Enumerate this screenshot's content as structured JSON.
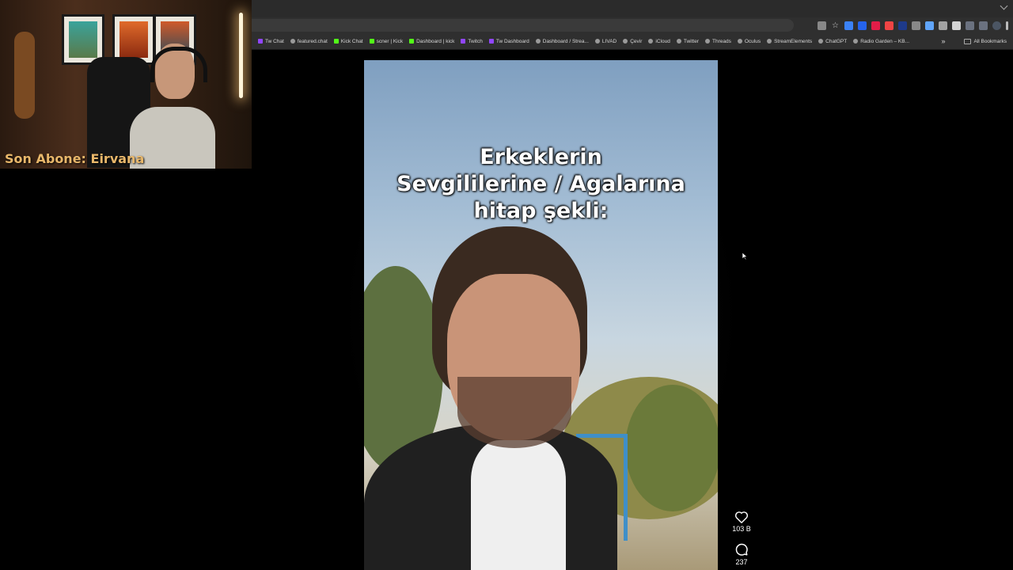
{
  "browser": {
    "bookmarks": [
      {
        "label": "Tw Chat",
        "icon": "twitch-icon"
      },
      {
        "label": "featured.chat",
        "icon": "globe-icon"
      },
      {
        "label": "Kick Chat",
        "icon": "kick-icon"
      },
      {
        "label": "scner | Kick",
        "icon": "kick-icon"
      },
      {
        "label": "Dashboard | kick",
        "icon": "kick-icon"
      },
      {
        "label": "Twitch",
        "icon": "twitch-icon"
      },
      {
        "label": "Tw Dashboard",
        "icon": "twitch-icon"
      },
      {
        "label": "Dashboard / Strea...",
        "icon": "streamelements-icon"
      },
      {
        "label": "LIVAD",
        "icon": "globe-icon"
      },
      {
        "label": "Çevir",
        "icon": "translate-icon"
      },
      {
        "label": "iCloud",
        "icon": "icloud-icon"
      },
      {
        "label": "Twitter",
        "icon": "globe-icon"
      },
      {
        "label": "Threads",
        "icon": "globe-icon"
      },
      {
        "label": "Oculus",
        "icon": "globe-icon"
      },
      {
        "label": "StreamElements",
        "icon": "globe-icon"
      },
      {
        "label": "ChatGPT",
        "icon": "globe-icon"
      },
      {
        "label": "Radio Garden – KB...",
        "icon": "globe-icon"
      }
    ],
    "more_bookmarks_label": "»",
    "all_bookmarks_label": "All Bookmarks"
  },
  "webcam": {
    "subscriber_text": "Son Abone: Eirvana"
  },
  "video": {
    "caption_lines": [
      "Erkeklerin",
      "Sevgililerine / Agalarına",
      "hitap şekli:"
    ]
  },
  "actions": {
    "like_count": "103 B",
    "comment_count": "237"
  },
  "colors": {
    "background": "#000000",
    "subscriber_text": "#e8b76a",
    "chrome": "#2f2f2f"
  }
}
